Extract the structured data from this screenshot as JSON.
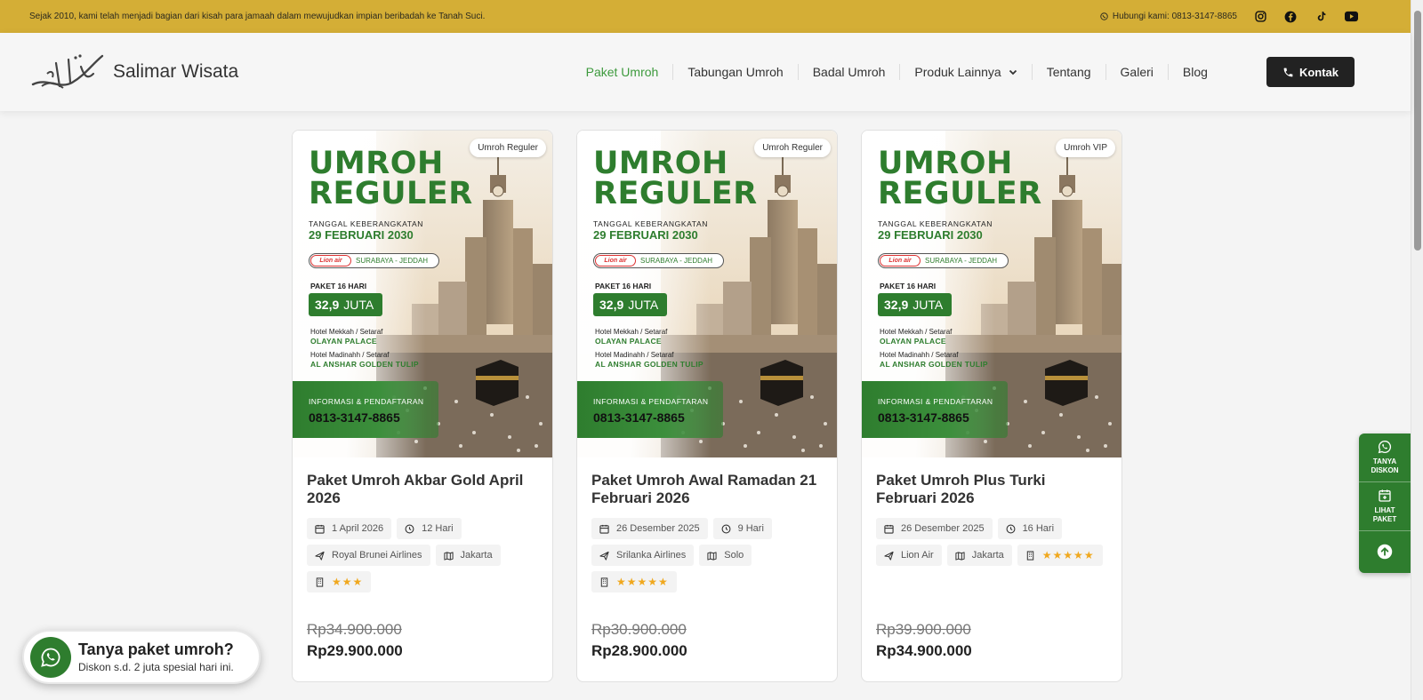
{
  "topbar": {
    "tagline": "Sejak 2010, kami telah menjadi bagian dari kisah para jamaah dalam mewujudkan impian beribadah ke Tanah Suci.",
    "contact": "Hubungi kami: 0813-3147-8865",
    "socials": [
      "instagram-icon",
      "facebook-icon",
      "tiktok-icon",
      "youtube-icon"
    ]
  },
  "header": {
    "brand": "Salimar Wisata",
    "nav": [
      {
        "label": "Paket Umroh"
      },
      {
        "label": "Tabungan Umroh"
      },
      {
        "label": "Badal Umroh"
      },
      {
        "label": "Produk Lainnya"
      },
      {
        "label": "Tentang"
      },
      {
        "label": "Galeri"
      },
      {
        "label": "Blog"
      }
    ],
    "kontak": "Kontak"
  },
  "poster": {
    "title_line1": "UMROH",
    "title_line2": "REGULER",
    "date_label": "TANGGAL KEBERANGKATAN",
    "date": "29 FEBRUARI 2030",
    "airline_logo": "Lion air",
    "route": "SURABAYA - JEDDAH",
    "package": "PAKET 16 HARI",
    "price_num": "32,9",
    "price_unit": "JUTA",
    "hotel1_label": "Hotel Mekkah / Setaraf",
    "hotel1": "OLAYAN PALACE",
    "hotel2_label": "Hotel Madinahh / Setaraf",
    "hotel2": "AL ANSHAR GOLDEN TULIP",
    "info_label": "INFORMASI & PENDAFTARAN",
    "info_phone": "0813-3147-8865"
  },
  "cards": [
    {
      "badge": "Umroh Reguler",
      "title": "Paket Umroh Akbar Gold April 2026",
      "date": "1 April 2026",
      "duration": "12 Hari",
      "airline": "Royal Brunei Airlines",
      "city": "Jakarta",
      "stars": "★★★",
      "old_price": "Rp34.900.000",
      "price": "Rp29.900.000"
    },
    {
      "badge": "Umroh Reguler",
      "title": "Paket Umroh Awal Ramadan 21 Februari 2026",
      "date": "26 Desember 2025",
      "duration": "9 Hari",
      "airline": "Srilanka Airlines",
      "city": "Solo",
      "stars": "★★★★★",
      "old_price": "Rp30.900.000",
      "price": "Rp28.900.000"
    },
    {
      "badge": "Umroh VIP",
      "title": "Paket Umroh Plus Turki Februari 2026",
      "date": "26 Desember 2025",
      "duration": "16 Hari",
      "airline": "Lion Air",
      "city": "Jakarta",
      "stars": "★★★★★",
      "old_price": "Rp39.900.000",
      "price": "Rp34.900.000"
    }
  ],
  "fab": {
    "title": "Tanya paket umroh?",
    "subtitle": "Diskon s.d. 2 juta spesial hari ini."
  },
  "side": {
    "btn1_line1": "TANYA",
    "btn1_line2": "DISKON",
    "btn2_line1": "LIHAT",
    "btn2_line2": "PAKET"
  },
  "colors": {
    "topbar": "#d4ae36",
    "accent_green": "#2e7d2e",
    "nav_active": "#3d9a3d",
    "stars": "#f0a81e"
  }
}
